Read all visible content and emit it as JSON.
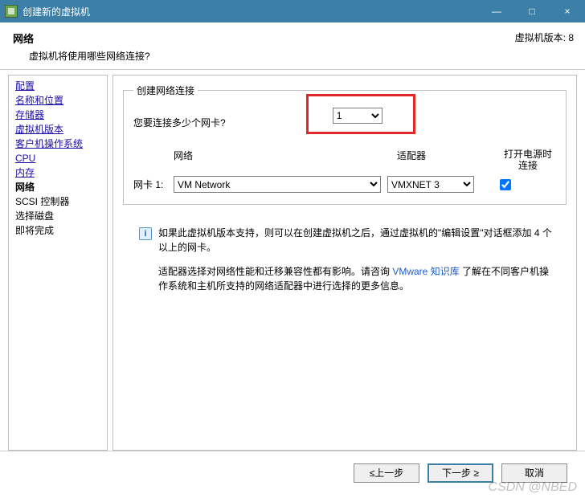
{
  "window": {
    "title": "创建新的虚拟机",
    "minimize": "—",
    "maximize": "□",
    "close": "×"
  },
  "header": {
    "title": "网络",
    "subtitle": "虚拟机将使用哪些网络连接?",
    "version_label": "虚拟机版本: 8"
  },
  "sidebar": {
    "items": [
      {
        "label": "配置",
        "state": "visited"
      },
      {
        "label": "名称和位置",
        "state": "visited"
      },
      {
        "label": "存储器",
        "state": "visited"
      },
      {
        "label": "虚拟机版本",
        "state": "visited"
      },
      {
        "label": "客户机操作系统",
        "state": "visited"
      },
      {
        "label": "CPU",
        "state": "visited"
      },
      {
        "label": "内存",
        "state": "visited"
      },
      {
        "label": "网络",
        "state": "current"
      },
      {
        "label": "SCSI 控制器",
        "state": "future"
      },
      {
        "label": "选择磁盘",
        "state": "future"
      },
      {
        "label": "即将完成",
        "state": "future"
      }
    ]
  },
  "main": {
    "group_title": "创建网络连接",
    "question": "您要连接多少个网卡?",
    "nic_count_value": "1",
    "col_network": "网络",
    "col_adapter": "适配器",
    "col_power": "打开电源时连接",
    "nic_row": {
      "label": "网卡 1:",
      "network_value": "VM Network",
      "adapter_value": "VMXNET 3",
      "connect_on_power": true
    },
    "info1": "如果此虚拟机版本支持，则可以在创建虚拟机之后，通过虚拟机的\"编辑设置\"对话框添加 4 个以上的网卡。",
    "info2a": "适配器选择对网络性能和迁移兼容性都有影响。请咨询 ",
    "kb_link_text": "VMware 知识库",
    "info2b": " 了解在不同客户机操作系统和主机所支持的网络适配器中进行选择的更多信息。"
  },
  "footer": {
    "back": "≤上一步",
    "next": "下一步 ≥",
    "cancel": "取消"
  },
  "watermark": "CSDN @NBED"
}
